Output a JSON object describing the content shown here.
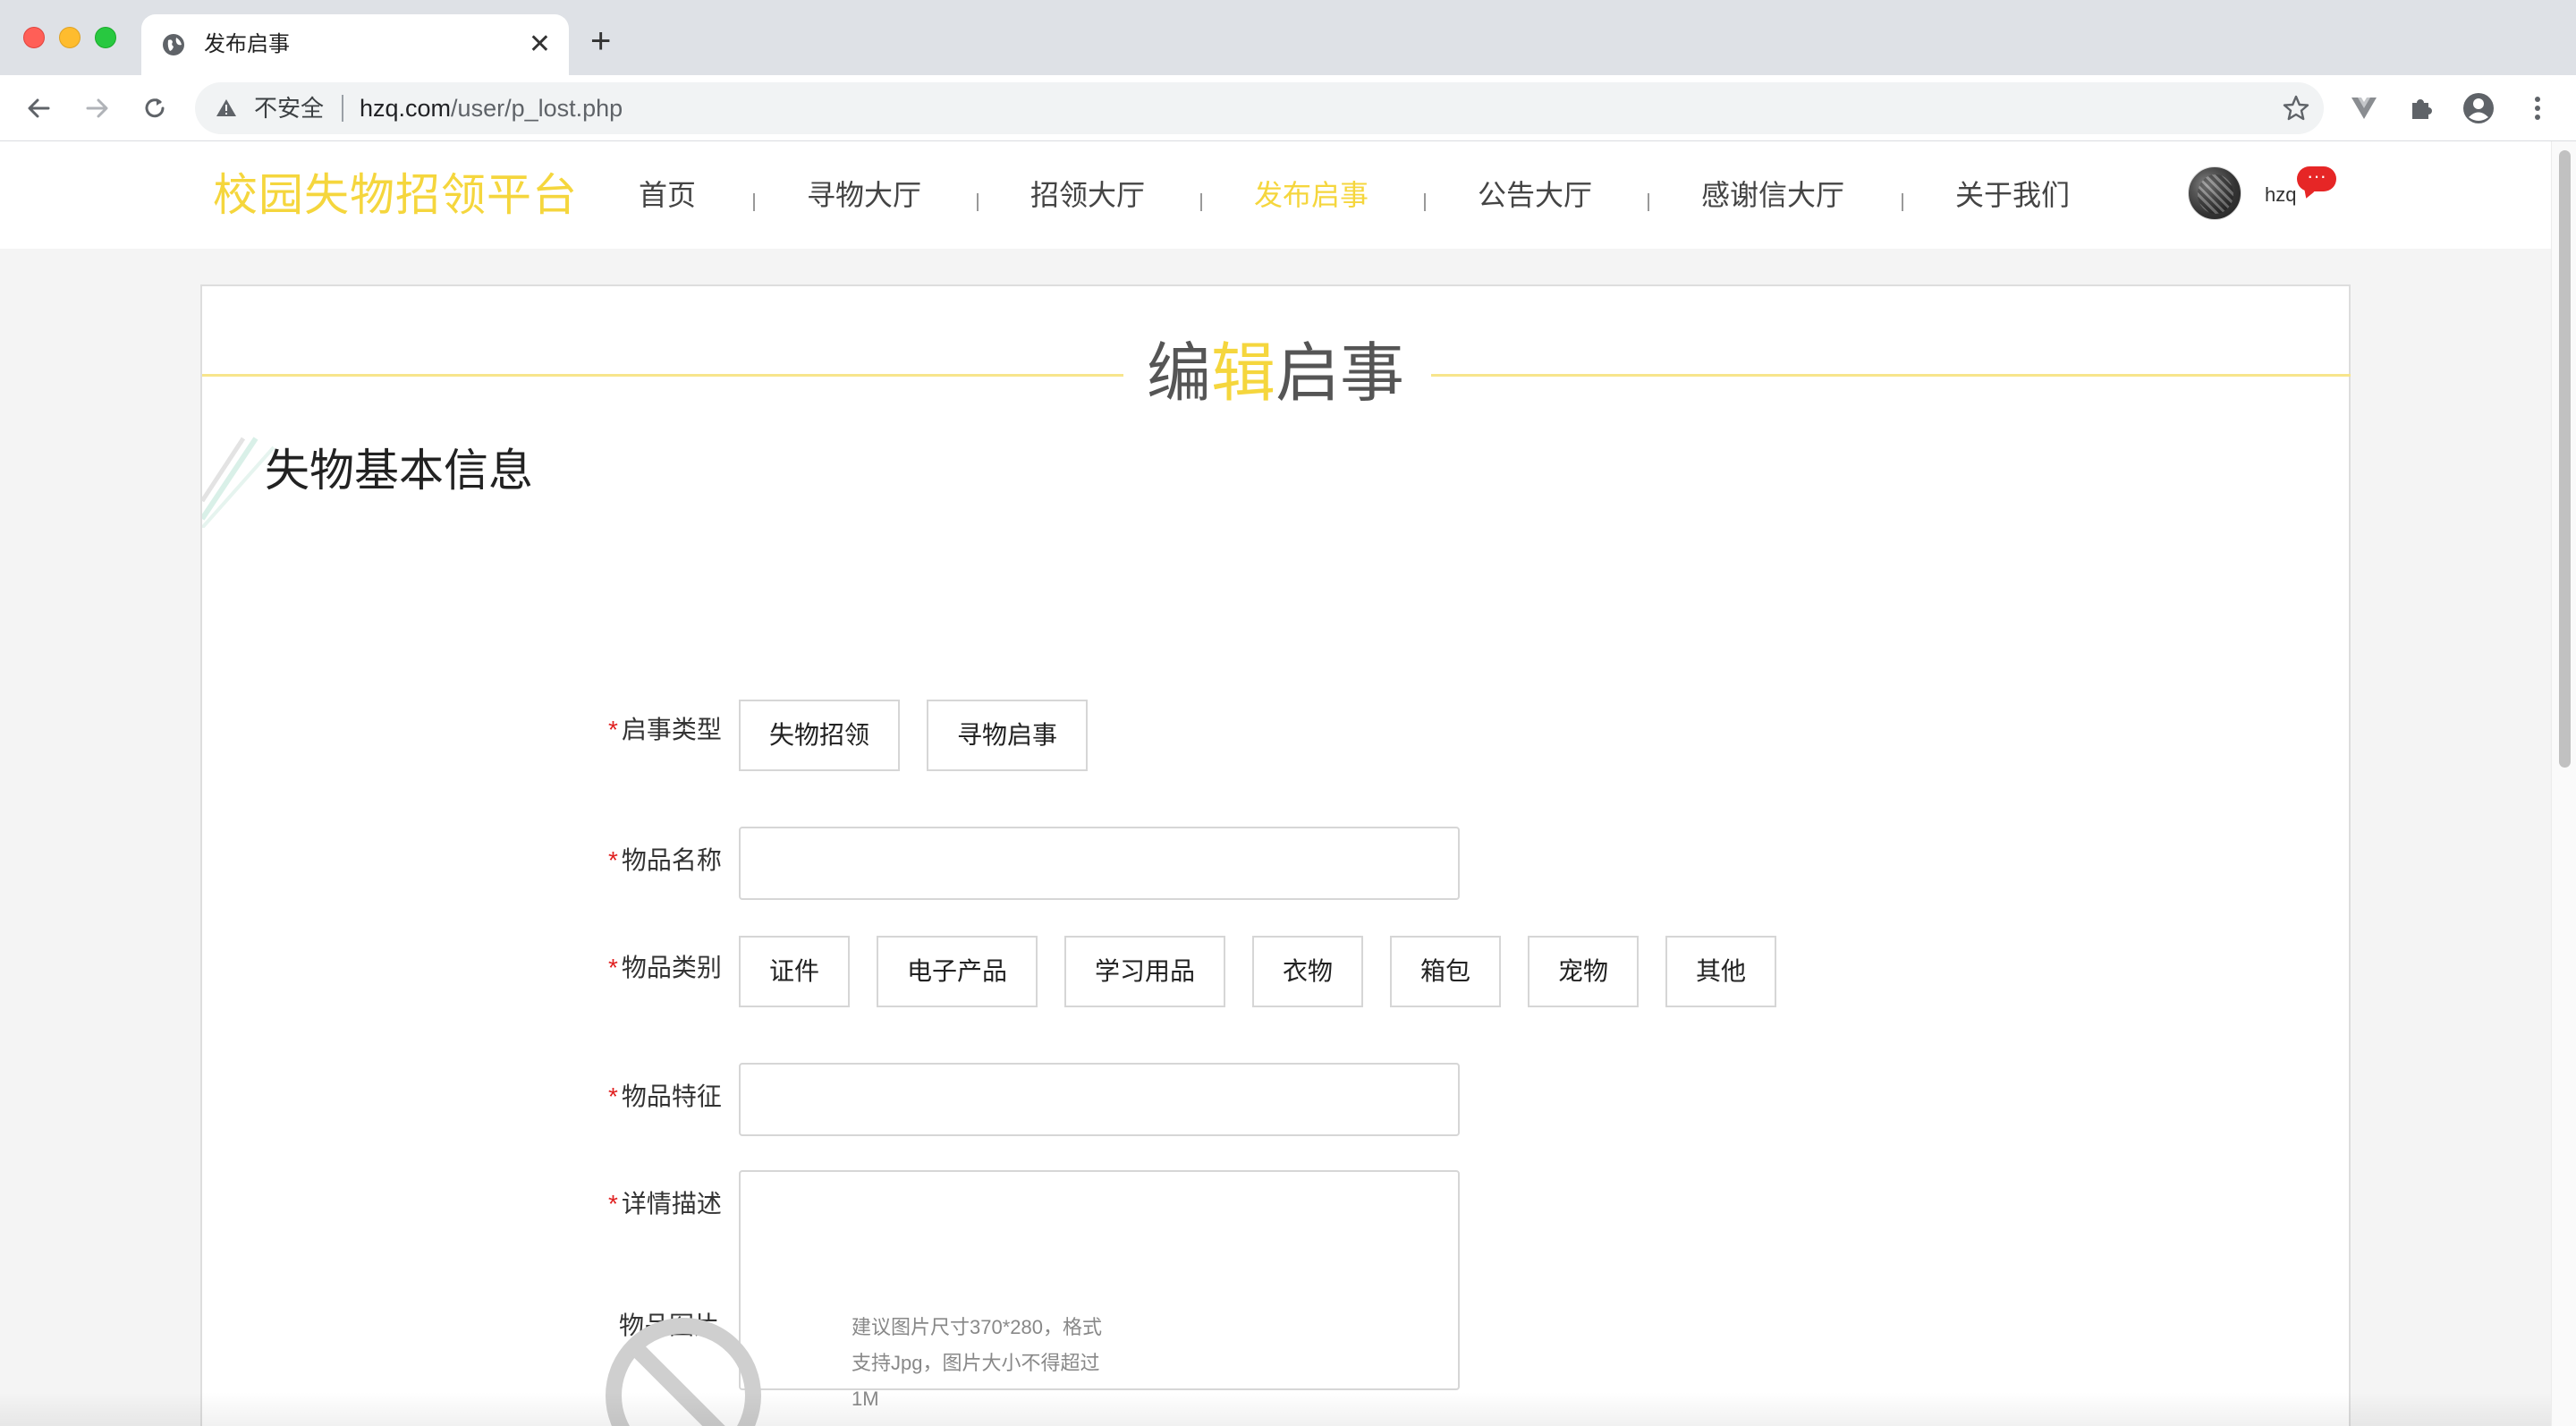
{
  "browser": {
    "tab_title": "发布启事",
    "tab_close": "✕",
    "new_tab": "+",
    "security_label": "不安全",
    "url_host": "hzq.com",
    "url_path": "/user/p_lost.php"
  },
  "site": {
    "logo": "校园失物招领平台",
    "accent_color": "#f5d63d",
    "nav": [
      {
        "label": "首页",
        "active": false
      },
      {
        "label": "寻物大厅",
        "active": false
      },
      {
        "label": "招领大厅",
        "active": false
      },
      {
        "label": "发布启事",
        "active": true
      },
      {
        "label": "公告大厅",
        "active": false
      },
      {
        "label": "感谢信大厅",
        "active": false
      },
      {
        "label": "关于我们",
        "active": false
      }
    ],
    "username": "hzq",
    "message_badge": "···"
  },
  "form": {
    "title_prefix": "编",
    "title_highlight": "辑",
    "title_suffix": "启事",
    "section_title": "失物基本信息",
    "required_mark": "*",
    "notice_type_label": "启事类型",
    "notice_types": [
      "失物招领",
      "寻物启事"
    ],
    "item_name_label": "物品名称",
    "item_name_value": "",
    "category_label": "物品类别",
    "categories": [
      "证件",
      "电子产品",
      "学习用品",
      "衣物",
      "箱包",
      "宠物",
      "其他"
    ],
    "feature_label": "物品特征",
    "feature_value": "",
    "description_label": "详情描述",
    "description_value": "",
    "image_label": "物品图片",
    "image_hint": "建议图片尺寸370*280，格式支持Jpg，图片大小不得超过1M"
  }
}
